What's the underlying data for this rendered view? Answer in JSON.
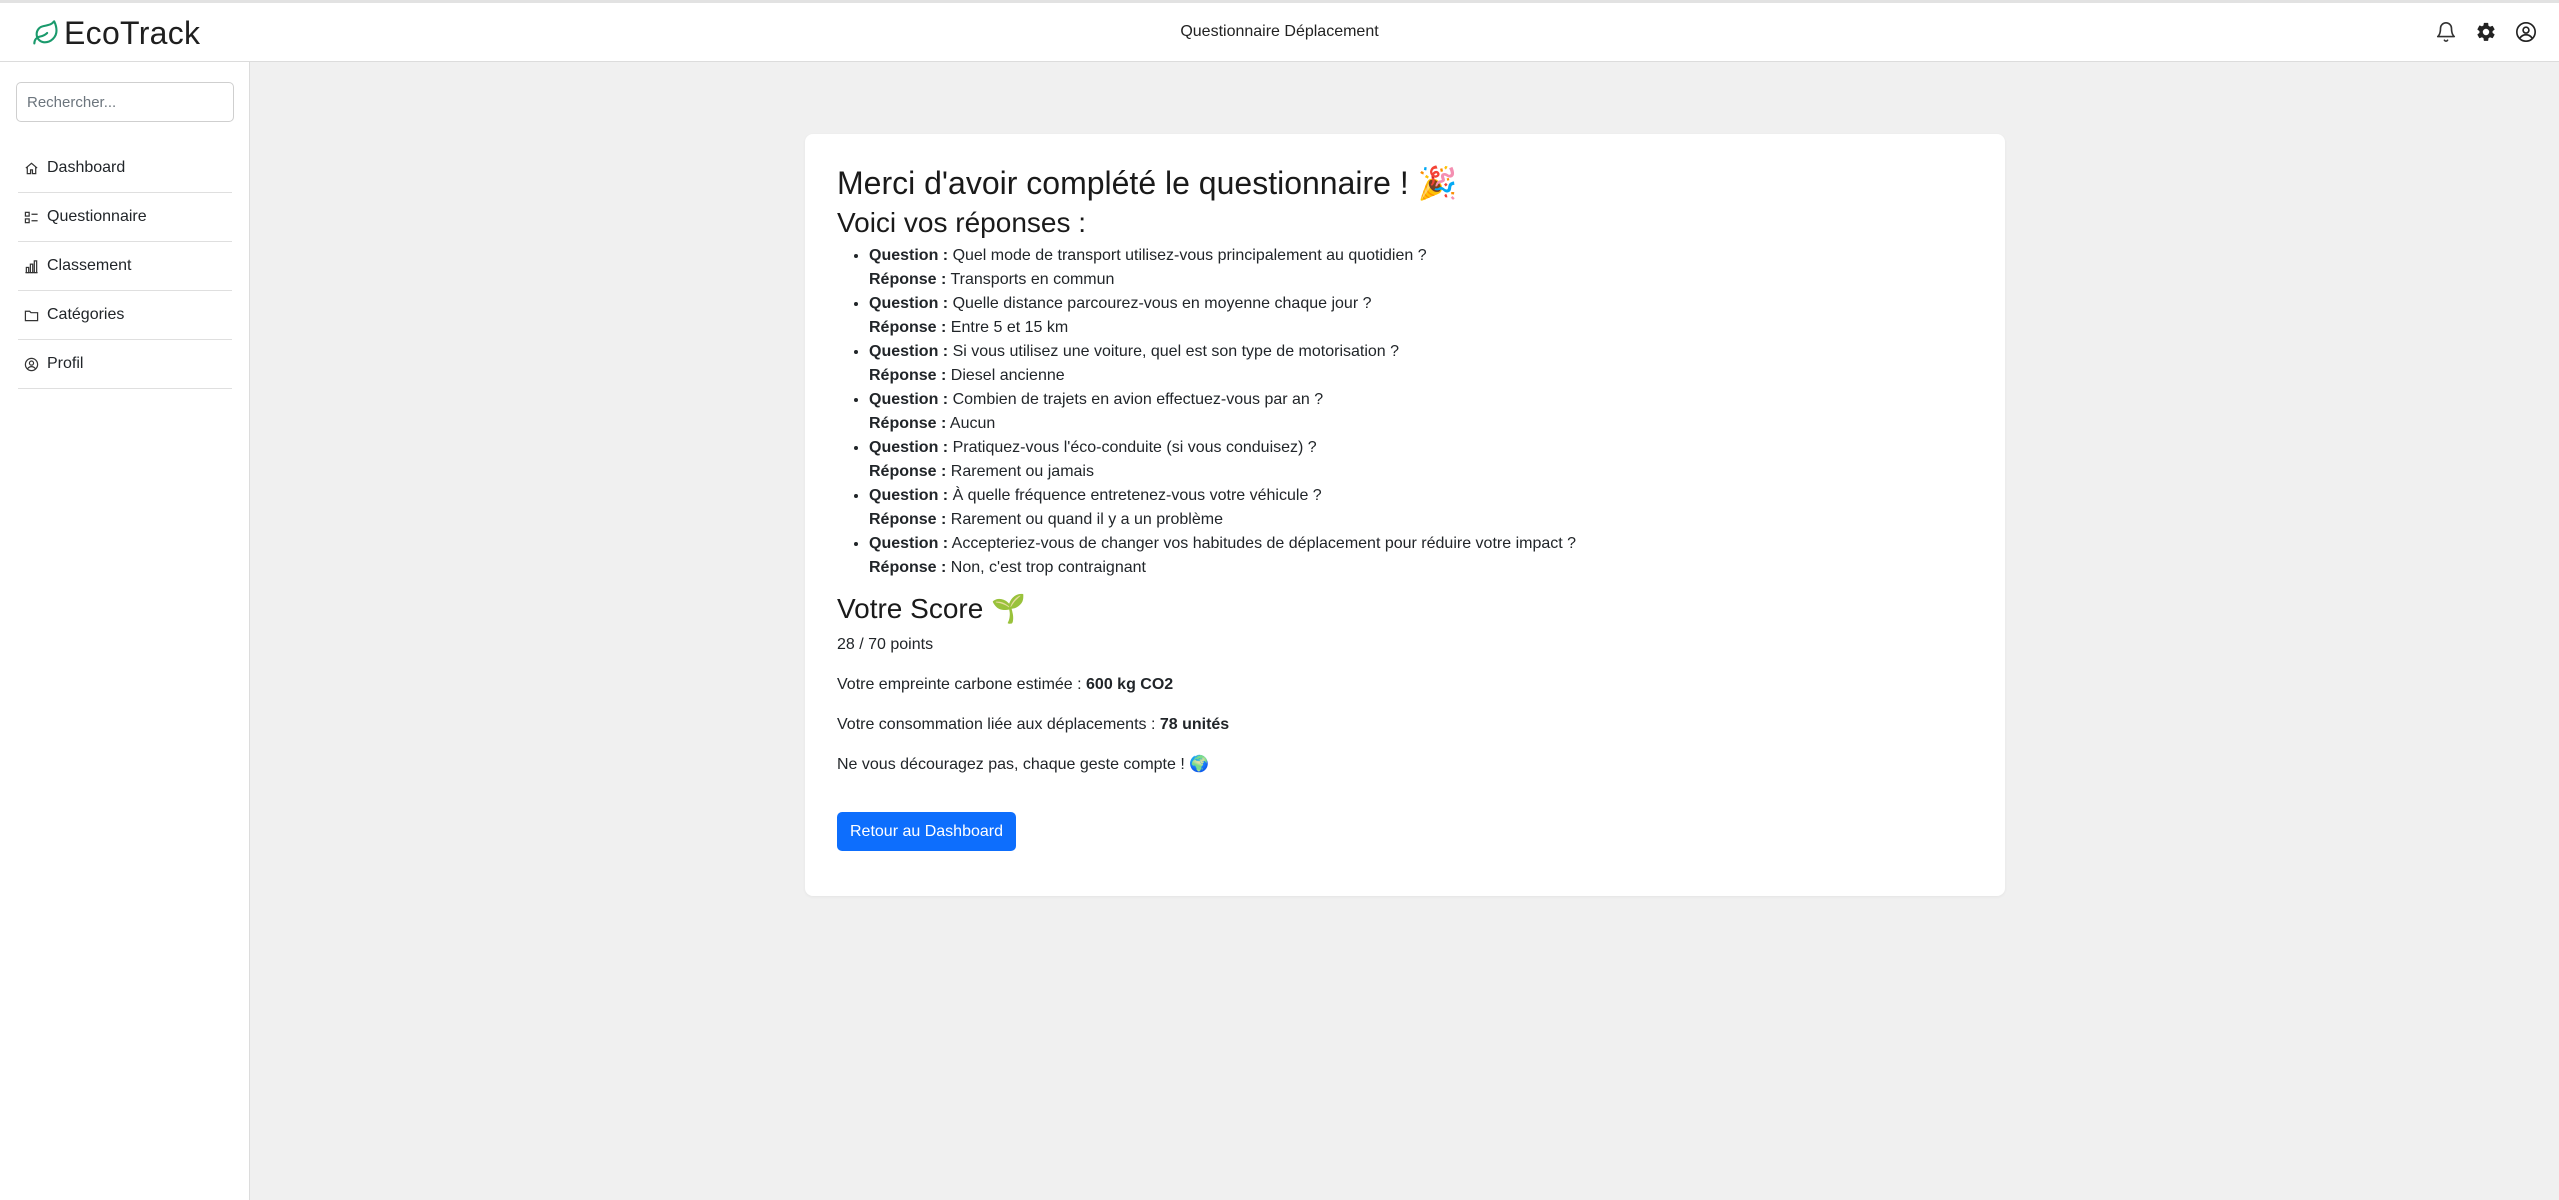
{
  "app": {
    "name": "EcoTrack",
    "page_title": "Questionnaire Déplacement"
  },
  "header_icons": [
    "bell-icon",
    "gear-icon",
    "user-circle-icon"
  ],
  "sidebar": {
    "search_placeholder": "Rechercher...",
    "items": [
      {
        "label": "Dashboard",
        "icon": "home-icon"
      },
      {
        "label": "Questionnaire",
        "icon": "list-icon"
      },
      {
        "label": "Classement",
        "icon": "bar-chart-icon"
      },
      {
        "label": "Catégories",
        "icon": "folder-icon"
      },
      {
        "label": "Profil",
        "icon": "user-icon"
      }
    ]
  },
  "main": {
    "thanks_title": "Merci d'avoir complété le questionnaire ! 🎉",
    "answers_title": "Voici vos réponses :",
    "question_label": "Question :",
    "answer_label": "Réponse :",
    "answers": [
      {
        "q": "Quel mode de transport utilisez-vous principalement au quotidien ?",
        "a": "Transports en commun"
      },
      {
        "q": "Quelle distance parcourez-vous en moyenne chaque jour ?",
        "a": "Entre 5 et 15 km"
      },
      {
        "q": "Si vous utilisez une voiture, quel est son type de motorisation ?",
        "a": "Diesel ancienne"
      },
      {
        "q": "Combien de trajets en avion effectuez-vous par an ?",
        "a": "Aucun"
      },
      {
        "q": "Pratiquez-vous l'éco-conduite (si vous conduisez) ?",
        "a": "Rarement ou jamais"
      },
      {
        "q": "À quelle fréquence entretenez-vous votre véhicule ?",
        "a": "Rarement ou quand il y a un problème"
      },
      {
        "q": "Accepteriez-vous de changer vos habitudes de déplacement pour réduire votre impact ?",
        "a": "Non, c'est trop contraignant"
      }
    ],
    "score_title": "Votre Score 🌱",
    "score_text": "28 / 70 points",
    "carbon_label": "Votre empreinte carbone estimée : ",
    "carbon_value": "600 kg CO2",
    "consumption_label": "Votre consommation liée aux déplacements : ",
    "consumption_value": "78 unités",
    "encouragement": "Ne vous découragez pas, chaque geste compte ! 🌍",
    "back_button": "Retour au Dashboard"
  },
  "colors": {
    "primary": "#0d6efd",
    "logo_green": "#1a9a6c",
    "background": "#f0f0f0"
  }
}
